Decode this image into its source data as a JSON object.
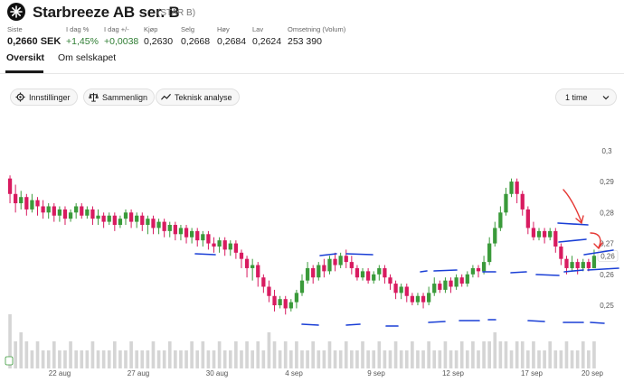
{
  "header": {
    "title": "Starbreeze AB ser. B",
    "ticker": "(STAR B)"
  },
  "stats": [
    {
      "label": "Siste",
      "value": "0,2660 SEK",
      "style": "big"
    },
    {
      "label": "I dag %",
      "value": "+1,45%",
      "style": "pos"
    },
    {
      "label": "I dag +/-",
      "value": "+0,0038",
      "style": "pos"
    },
    {
      "label": "Kjøp",
      "value": "0,2630",
      "style": ""
    },
    {
      "label": "Selg",
      "value": "0,2668",
      "style": ""
    },
    {
      "label": "Høy",
      "value": "0,2684",
      "style": ""
    },
    {
      "label": "Lav",
      "value": "0,2624",
      "style": ""
    },
    {
      "label": "Omsetning (Volum)",
      "value": "253 390",
      "style": ""
    }
  ],
  "tabs": [
    {
      "label": "Oversikt",
      "active": true
    },
    {
      "label": "Om selskapet",
      "active": false
    }
  ],
  "toolbar": {
    "settings_label": "Innstillinger",
    "compare_label": "Sammenlign",
    "technical_label": "Teknisk analyse",
    "interval_value": "1 time"
  },
  "colors": {
    "up": "#3a9a3a",
    "down": "#d81b60",
    "annotation_blue": "#1a3fd6",
    "annotation_red": "#e53935"
  },
  "chart_data": {
    "type": "candlestick",
    "x_tick_labels": [
      "22 aug",
      "27 aug",
      "30 aug",
      "4 sep",
      "9 sep",
      "12 sep",
      "17 sep",
      "20 sep"
    ],
    "y_tick_labels": [
      "0,3",
      "0,29",
      "0,28",
      "0,27",
      "0,26",
      "0,25"
    ],
    "ylim": [
      0.243,
      0.302
    ],
    "last_price_label": "0,2660",
    "candles": [
      [
        0.291,
        0.286,
        0.292,
        0.283
      ],
      [
        0.286,
        0.283,
        0.289,
        0.28
      ],
      [
        0.283,
        0.285,
        0.287,
        0.281
      ],
      [
        0.285,
        0.281,
        0.286,
        0.279
      ],
      [
        0.281,
        0.284,
        0.286,
        0.28
      ],
      [
        0.284,
        0.282,
        0.285,
        0.279
      ],
      [
        0.282,
        0.28,
        0.284,
        0.278
      ],
      [
        0.28,
        0.282,
        0.283,
        0.278
      ],
      [
        0.282,
        0.279,
        0.283,
        0.277
      ],
      [
        0.279,
        0.281,
        0.282,
        0.277
      ],
      [
        0.281,
        0.278,
        0.282,
        0.276
      ],
      [
        0.278,
        0.28,
        0.281,
        0.277
      ],
      [
        0.28,
        0.282,
        0.283,
        0.278
      ],
      [
        0.282,
        0.279,
        0.283,
        0.278
      ],
      [
        0.279,
        0.281,
        0.282,
        0.278
      ],
      [
        0.281,
        0.278,
        0.282,
        0.276
      ],
      [
        0.278,
        0.279,
        0.281,
        0.276
      ],
      [
        0.279,
        0.277,
        0.28,
        0.275
      ],
      [
        0.277,
        0.279,
        0.28,
        0.276
      ],
      [
        0.279,
        0.276,
        0.28,
        0.274
      ],
      [
        0.276,
        0.278,
        0.279,
        0.275
      ],
      [
        0.278,
        0.28,
        0.281,
        0.276
      ],
      [
        0.28,
        0.277,
        0.281,
        0.275
      ],
      [
        0.277,
        0.279,
        0.28,
        0.275
      ],
      [
        0.279,
        0.276,
        0.28,
        0.274
      ],
      [
        0.276,
        0.278,
        0.279,
        0.273
      ],
      [
        0.278,
        0.275,
        0.279,
        0.273
      ],
      [
        0.275,
        0.277,
        0.278,
        0.273
      ],
      [
        0.277,
        0.274,
        0.278,
        0.272
      ],
      [
        0.274,
        0.276,
        0.277,
        0.272
      ],
      [
        0.276,
        0.273,
        0.277,
        0.271
      ],
      [
        0.273,
        0.275,
        0.276,
        0.271
      ],
      [
        0.275,
        0.272,
        0.276,
        0.27
      ],
      [
        0.272,
        0.274,
        0.275,
        0.27
      ],
      [
        0.274,
        0.271,
        0.275,
        0.269
      ],
      [
        0.271,
        0.273,
        0.274,
        0.269
      ],
      [
        0.273,
        0.27,
        0.274,
        0.268
      ],
      [
        0.27,
        0.269,
        0.272,
        0.267
      ],
      [
        0.269,
        0.271,
        0.272,
        0.267
      ],
      [
        0.271,
        0.268,
        0.272,
        0.266
      ],
      [
        0.268,
        0.27,
        0.271,
        0.266
      ],
      [
        0.27,
        0.267,
        0.271,
        0.265
      ],
      [
        0.267,
        0.265,
        0.268,
        0.262
      ],
      [
        0.265,
        0.262,
        0.266,
        0.259
      ],
      [
        0.262,
        0.263,
        0.265,
        0.258
      ],
      [
        0.263,
        0.259,
        0.264,
        0.256
      ],
      [
        0.259,
        0.256,
        0.26,
        0.254
      ],
      [
        0.256,
        0.253,
        0.258,
        0.251
      ],
      [
        0.253,
        0.25,
        0.255,
        0.248
      ],
      [
        0.25,
        0.252,
        0.253,
        0.249
      ],
      [
        0.252,
        0.249,
        0.253,
        0.247
      ],
      [
        0.249,
        0.251,
        0.252,
        0.248
      ],
      [
        0.251,
        0.254,
        0.255,
        0.249
      ],
      [
        0.254,
        0.258,
        0.26,
        0.253
      ],
      [
        0.258,
        0.262,
        0.264,
        0.257
      ],
      [
        0.262,
        0.259,
        0.263,
        0.257
      ],
      [
        0.259,
        0.263,
        0.264,
        0.258
      ],
      [
        0.263,
        0.261,
        0.265,
        0.259
      ],
      [
        0.261,
        0.265,
        0.266,
        0.26
      ],
      [
        0.265,
        0.263,
        0.267,
        0.261
      ],
      [
        0.263,
        0.266,
        0.267,
        0.262
      ],
      [
        0.266,
        0.264,
        0.268,
        0.262
      ],
      [
        0.264,
        0.262,
        0.266,
        0.26
      ],
      [
        0.262,
        0.259,
        0.263,
        0.258
      ],
      [
        0.259,
        0.261,
        0.262,
        0.258
      ],
      [
        0.261,
        0.258,
        0.262,
        0.257
      ],
      [
        0.258,
        0.26,
        0.261,
        0.257
      ],
      [
        0.26,
        0.262,
        0.263,
        0.258
      ],
      [
        0.262,
        0.259,
        0.263,
        0.257
      ],
      [
        0.259,
        0.257,
        0.26,
        0.255
      ],
      [
        0.257,
        0.254,
        0.258,
        0.252
      ],
      [
        0.254,
        0.256,
        0.257,
        0.252
      ],
      [
        0.256,
        0.253,
        0.257,
        0.251
      ],
      [
        0.253,
        0.251,
        0.254,
        0.25
      ],
      [
        0.251,
        0.253,
        0.254,
        0.25
      ],
      [
        0.253,
        0.251,
        0.254,
        0.249
      ],
      [
        0.251,
        0.254,
        0.256,
        0.25
      ],
      [
        0.254,
        0.257,
        0.259,
        0.253
      ],
      [
        0.257,
        0.255,
        0.258,
        0.254
      ],
      [
        0.255,
        0.258,
        0.259,
        0.254
      ],
      [
        0.258,
        0.256,
        0.259,
        0.254
      ],
      [
        0.256,
        0.259,
        0.26,
        0.255
      ],
      [
        0.259,
        0.257,
        0.26,
        0.256
      ],
      [
        0.257,
        0.26,
        0.261,
        0.256
      ],
      [
        0.26,
        0.262,
        0.263,
        0.259
      ],
      [
        0.262,
        0.261,
        0.263,
        0.259
      ],
      [
        0.261,
        0.264,
        0.266,
        0.26
      ],
      [
        0.264,
        0.27,
        0.272,
        0.263
      ],
      [
        0.27,
        0.275,
        0.277,
        0.269
      ],
      [
        0.275,
        0.28,
        0.282,
        0.274
      ],
      [
        0.28,
        0.286,
        0.288,
        0.279
      ],
      [
        0.286,
        0.29,
        0.291,
        0.285
      ],
      [
        0.29,
        0.286,
        0.291,
        0.283
      ],
      [
        0.286,
        0.281,
        0.287,
        0.279
      ],
      [
        0.281,
        0.275,
        0.282,
        0.273
      ],
      [
        0.275,
        0.272,
        0.277,
        0.271
      ],
      [
        0.272,
        0.274,
        0.275,
        0.271
      ],
      [
        0.274,
        0.272,
        0.275,
        0.27
      ],
      [
        0.272,
        0.274,
        0.275,
        0.271
      ],
      [
        0.274,
        0.269,
        0.275,
        0.267
      ],
      [
        0.269,
        0.265,
        0.27,
        0.263
      ],
      [
        0.265,
        0.262,
        0.266,
        0.26
      ],
      [
        0.262,
        0.264,
        0.266,
        0.261
      ],
      [
        0.264,
        0.262,
        0.265,
        0.26
      ],
      [
        0.262,
        0.264,
        0.265,
        0.261
      ],
      [
        0.264,
        0.262,
        0.265,
        0.261
      ],
      [
        0.262,
        0.266,
        0.268,
        0.262
      ]
    ],
    "volumes": [
      6,
      3,
      4,
      3,
      2,
      3,
      2,
      2,
      3,
      2,
      2,
      3,
      2,
      2,
      2,
      3,
      2,
      2,
      2,
      3,
      2,
      2,
      3,
      2,
      2,
      2,
      3,
      2,
      2,
      3,
      2,
      2,
      2,
      3,
      2,
      3,
      2,
      2,
      3,
      2,
      2,
      3,
      2,
      3,
      2,
      3,
      2,
      4,
      3,
      2,
      3,
      2,
      3,
      2,
      2,
      3,
      2,
      2,
      3,
      2,
      2,
      3,
      2,
      2,
      3,
      2,
      2,
      3,
      2,
      2,
      3,
      2,
      2,
      3,
      2,
      2,
      3,
      2,
      2,
      3,
      2,
      2,
      3,
      2,
      3,
      2,
      3,
      3,
      4,
      3,
      3,
      2,
      3,
      3,
      2,
      3,
      2,
      2,
      3,
      2,
      2,
      3,
      2,
      2,
      3,
      2,
      3
    ]
  }
}
